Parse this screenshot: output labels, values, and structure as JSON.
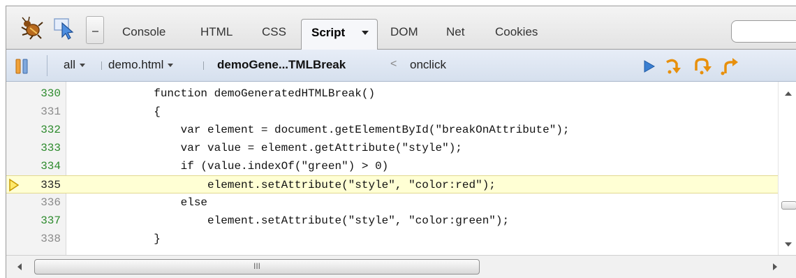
{
  "tabs": {
    "console": "Console",
    "html": "HTML",
    "css": "CSS",
    "script": "Script",
    "dom": "DOM",
    "net": "Net",
    "cookies": "Cookies",
    "active": "script"
  },
  "breadcrumb": {
    "all": "all",
    "file": "demo.html",
    "function": "demoGene...TMLBreak",
    "separator": "<",
    "event": "onclick"
  },
  "code": {
    "current_line": "335",
    "lines": [
      {
        "num": "330",
        "text": "            function demoGeneratedHTMLBreak()",
        "executable": true
      },
      {
        "num": "331",
        "text": "            {",
        "executable": false
      },
      {
        "num": "332",
        "text": "                var element = document.getElementById(\"breakOnAttribute\");",
        "executable": true
      },
      {
        "num": "333",
        "text": "                var value = element.getAttribute(\"style\");",
        "executable": true
      },
      {
        "num": "334",
        "text": "                if (value.indexOf(\"green\") > 0)",
        "executable": true
      },
      {
        "num": "335",
        "text": "                    element.setAttribute(\"style\", \"color:red\");",
        "executable": true
      },
      {
        "num": "336",
        "text": "                else",
        "executable": false
      },
      {
        "num": "337",
        "text": "                    element.setAttribute(\"style\", \"color:green\");",
        "executable": true
      },
      {
        "num": "338",
        "text": "            }",
        "executable": false
      }
    ]
  },
  "scrollbar": {
    "grip": "III"
  },
  "icons": {
    "firebug": "bug-icon",
    "inspect": "inspect-cursor-icon",
    "pause": "pause-icon",
    "continue": "play-icon",
    "step_over": "step-over-icon",
    "step_into": "step-into-icon",
    "step_out": "step-out-icon",
    "breakpoint_marker": "current-line-arrow-icon"
  },
  "colors": {
    "executable_line": "#2c8a2c",
    "current_line_bg": "#ffffd4",
    "debugger_orange": "#e8900c",
    "continue_blue": "#3b7fd1"
  }
}
